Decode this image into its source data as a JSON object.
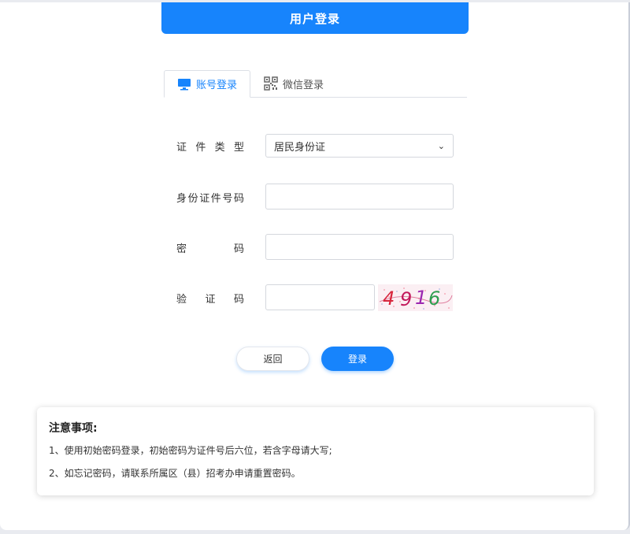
{
  "header": {
    "title": "用户登录"
  },
  "tabs": [
    {
      "label": "账号登录",
      "icon": "monitor-icon",
      "active": true
    },
    {
      "label": "微信登录",
      "icon": "qr-code-icon",
      "active": false
    }
  ],
  "form": {
    "id_type": {
      "label": "证 件 类 型",
      "value": "居民身份证"
    },
    "id_number": {
      "label": "身份证件号码",
      "value": "",
      "placeholder": ""
    },
    "password": {
      "label": "密 码",
      "value": "",
      "placeholder": ""
    },
    "captcha": {
      "label": "验 证 码",
      "value": "",
      "image_text": "4916"
    }
  },
  "buttons": {
    "back": "返回",
    "login": "登录"
  },
  "notice": {
    "title": "注意事项:",
    "items": [
      "1、使用初始密码登录，初始密码为证件号后六位，若含字母请大写;",
      "2、如忘记密码，请联系所属区（县）招考办申请重置密码。"
    ]
  },
  "colors": {
    "primary": "#1784fc",
    "background": "#e9ebf0"
  }
}
